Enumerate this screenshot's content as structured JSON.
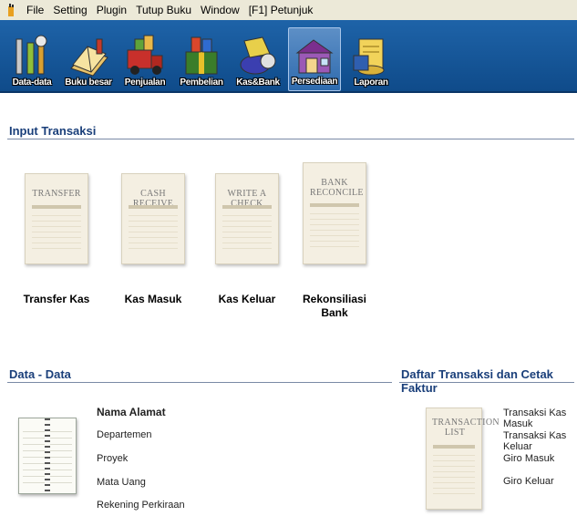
{
  "menu": {
    "items": [
      "File",
      "Setting",
      "Plugin",
      "Tutup Buku",
      "Window",
      "[F1] Petunjuk"
    ]
  },
  "toolbar": {
    "buttons": [
      {
        "label": "Data-data",
        "icon": "tools-icon"
      },
      {
        "label": "Buku besar",
        "icon": "ledger-icon"
      },
      {
        "label": "Penjualan",
        "icon": "sales-truck-icon"
      },
      {
        "label": "Pembelian",
        "icon": "purchase-gift-icon"
      },
      {
        "label": "Kas&Bank",
        "icon": "cash-bank-icon"
      },
      {
        "label": "Persediaan",
        "icon": "warehouse-icon"
      },
      {
        "label": "Laporan",
        "icon": "report-scroll-icon"
      }
    ],
    "active": "Persediaan"
  },
  "input_section": {
    "title": "Input Transaksi",
    "items": [
      {
        "doc_title": "TRANSFER",
        "caption": "Transfer Kas"
      },
      {
        "doc_title": "CASH RECEIVE",
        "caption": "Kas Masuk"
      },
      {
        "doc_title": "WRITE A CHECK",
        "caption": "Kas Keluar"
      },
      {
        "doc_title": "BANK RECONCILE",
        "caption": "Rekonsiliasi Bank"
      }
    ]
  },
  "data_section": {
    "title": "Data - Data",
    "links": [
      "Nama Alamat",
      "Departemen",
      "Proyek",
      "Mata Uang",
      "Rekening Perkiraan"
    ]
  },
  "daftar_section": {
    "title": "Daftar Transaksi dan Cetak Faktur",
    "doc_title": "TRANSACTION LIST",
    "links": [
      "Transaksi Kas Masuk",
      "Transaksi Kas Keluar",
      "Giro Masuk",
      "Giro Keluar"
    ]
  }
}
